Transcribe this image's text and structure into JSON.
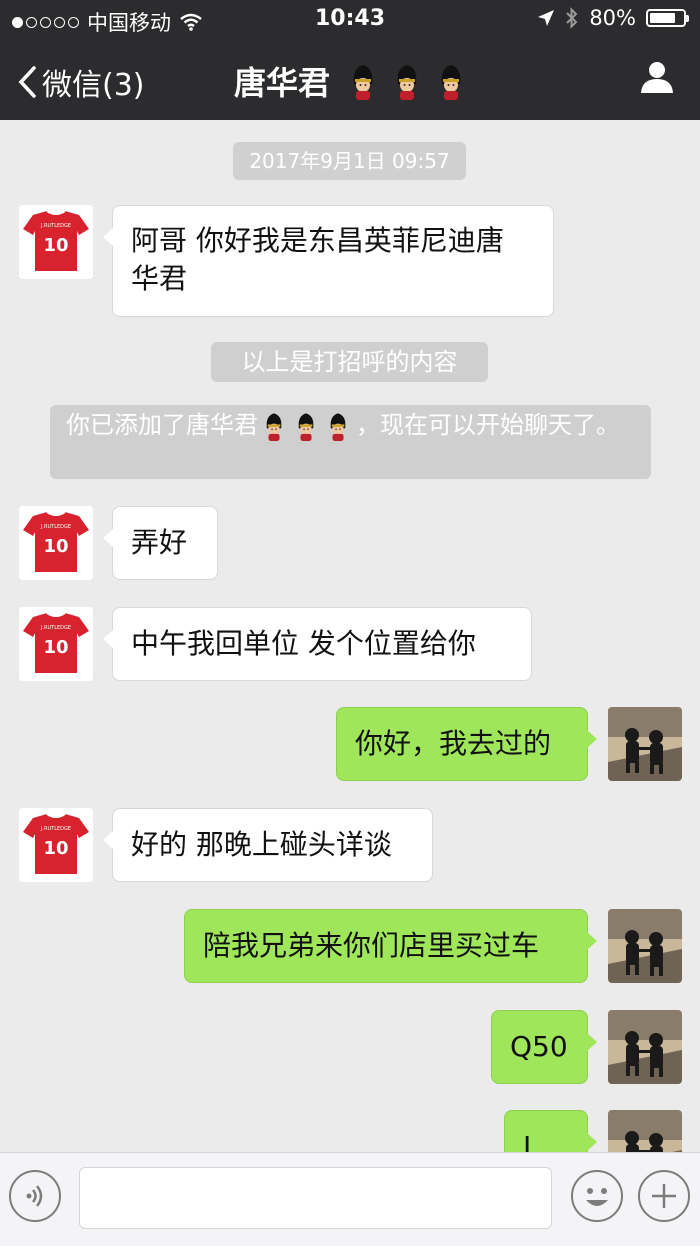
{
  "status_bar": {
    "carrier": "中国移动",
    "time": "10:43",
    "battery": "80%",
    "battery_level": 0.8,
    "signal_bars_filled": 1,
    "signal_bars_total": 5
  },
  "nav": {
    "back_label": "微信(3)",
    "title": "唐华君",
    "title_emoji": [
      "guard-emoji",
      "guard-emoji",
      "guard-emoji"
    ],
    "profile_icon": "person-icon"
  },
  "chat": {
    "timestamp": "2017年9月1日 09:57",
    "system_messages": {
      "greeting_notice": "以上是打招呼的内容",
      "added_notice_prefix": "你已添加了唐华君",
      "added_notice_suffix": "，现在可以开始聊天了。"
    },
    "messages": [
      {
        "from": "contact",
        "text_lines": [
          "阿哥 你好我是东昌英菲尼迪唐",
          "华君"
        ]
      },
      {
        "from": "contact",
        "text": "弄好"
      },
      {
        "from": "contact",
        "text": "中午我回单位 发个位置给你"
      },
      {
        "from": "me",
        "text": "你好，我去过的"
      },
      {
        "from": "contact",
        "text": "好的 那晚上碰头详谈"
      },
      {
        "from": "me",
        "text": "陪我兄弟来你们店里买过车"
      },
      {
        "from": "me",
        "text": "Q50"
      },
      {
        "from": "me",
        "text": "L"
      }
    ]
  },
  "input_bar": {
    "voice_icon": "voice-icon",
    "emoji_icon": "smiley-icon",
    "plus_icon": "plus-icon",
    "placeholder": ""
  },
  "colors": {
    "bar_bg": "#2c2c2e",
    "chat_bg": "#ebebeb",
    "outgoing_bubble": "#9fe65a",
    "incoming_bubble": "#ffffff"
  }
}
